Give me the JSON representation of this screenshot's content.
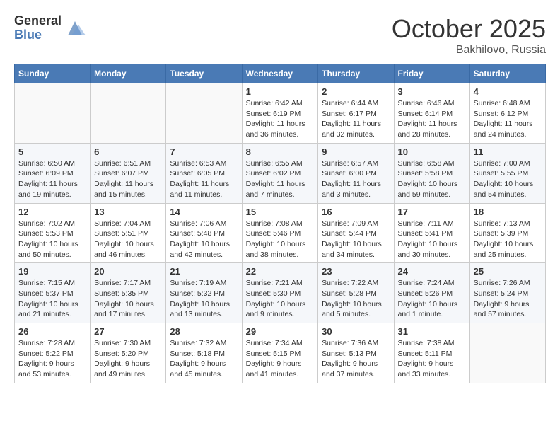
{
  "header": {
    "logo_general": "General",
    "logo_blue": "Blue",
    "month_title": "October 2025",
    "subtitle": "Bakhilovo, Russia"
  },
  "days_of_week": [
    "Sunday",
    "Monday",
    "Tuesday",
    "Wednesday",
    "Thursday",
    "Friday",
    "Saturday"
  ],
  "weeks": [
    [
      {
        "day": "",
        "info": ""
      },
      {
        "day": "",
        "info": ""
      },
      {
        "day": "",
        "info": ""
      },
      {
        "day": "1",
        "info": "Sunrise: 6:42 AM\nSunset: 6:19 PM\nDaylight: 11 hours\nand 36 minutes."
      },
      {
        "day": "2",
        "info": "Sunrise: 6:44 AM\nSunset: 6:17 PM\nDaylight: 11 hours\nand 32 minutes."
      },
      {
        "day": "3",
        "info": "Sunrise: 6:46 AM\nSunset: 6:14 PM\nDaylight: 11 hours\nand 28 minutes."
      },
      {
        "day": "4",
        "info": "Sunrise: 6:48 AM\nSunset: 6:12 PM\nDaylight: 11 hours\nand 24 minutes."
      }
    ],
    [
      {
        "day": "5",
        "info": "Sunrise: 6:50 AM\nSunset: 6:09 PM\nDaylight: 11 hours\nand 19 minutes."
      },
      {
        "day": "6",
        "info": "Sunrise: 6:51 AM\nSunset: 6:07 PM\nDaylight: 11 hours\nand 15 minutes."
      },
      {
        "day": "7",
        "info": "Sunrise: 6:53 AM\nSunset: 6:05 PM\nDaylight: 11 hours\nand 11 minutes."
      },
      {
        "day": "8",
        "info": "Sunrise: 6:55 AM\nSunset: 6:02 PM\nDaylight: 11 hours\nand 7 minutes."
      },
      {
        "day": "9",
        "info": "Sunrise: 6:57 AM\nSunset: 6:00 PM\nDaylight: 11 hours\nand 3 minutes."
      },
      {
        "day": "10",
        "info": "Sunrise: 6:58 AM\nSunset: 5:58 PM\nDaylight: 10 hours\nand 59 minutes."
      },
      {
        "day": "11",
        "info": "Sunrise: 7:00 AM\nSunset: 5:55 PM\nDaylight: 10 hours\nand 54 minutes."
      }
    ],
    [
      {
        "day": "12",
        "info": "Sunrise: 7:02 AM\nSunset: 5:53 PM\nDaylight: 10 hours\nand 50 minutes."
      },
      {
        "day": "13",
        "info": "Sunrise: 7:04 AM\nSunset: 5:51 PM\nDaylight: 10 hours\nand 46 minutes."
      },
      {
        "day": "14",
        "info": "Sunrise: 7:06 AM\nSunset: 5:48 PM\nDaylight: 10 hours\nand 42 minutes."
      },
      {
        "day": "15",
        "info": "Sunrise: 7:08 AM\nSunset: 5:46 PM\nDaylight: 10 hours\nand 38 minutes."
      },
      {
        "day": "16",
        "info": "Sunrise: 7:09 AM\nSunset: 5:44 PM\nDaylight: 10 hours\nand 34 minutes."
      },
      {
        "day": "17",
        "info": "Sunrise: 7:11 AM\nSunset: 5:41 PM\nDaylight: 10 hours\nand 30 minutes."
      },
      {
        "day": "18",
        "info": "Sunrise: 7:13 AM\nSunset: 5:39 PM\nDaylight: 10 hours\nand 25 minutes."
      }
    ],
    [
      {
        "day": "19",
        "info": "Sunrise: 7:15 AM\nSunset: 5:37 PM\nDaylight: 10 hours\nand 21 minutes."
      },
      {
        "day": "20",
        "info": "Sunrise: 7:17 AM\nSunset: 5:35 PM\nDaylight: 10 hours\nand 17 minutes."
      },
      {
        "day": "21",
        "info": "Sunrise: 7:19 AM\nSunset: 5:32 PM\nDaylight: 10 hours\nand 13 minutes."
      },
      {
        "day": "22",
        "info": "Sunrise: 7:21 AM\nSunset: 5:30 PM\nDaylight: 10 hours\nand 9 minutes."
      },
      {
        "day": "23",
        "info": "Sunrise: 7:22 AM\nSunset: 5:28 PM\nDaylight: 10 hours\nand 5 minutes."
      },
      {
        "day": "24",
        "info": "Sunrise: 7:24 AM\nSunset: 5:26 PM\nDaylight: 10 hours\nand 1 minute."
      },
      {
        "day": "25",
        "info": "Sunrise: 7:26 AM\nSunset: 5:24 PM\nDaylight: 9 hours\nand 57 minutes."
      }
    ],
    [
      {
        "day": "26",
        "info": "Sunrise: 7:28 AM\nSunset: 5:22 PM\nDaylight: 9 hours\nand 53 minutes."
      },
      {
        "day": "27",
        "info": "Sunrise: 7:30 AM\nSunset: 5:20 PM\nDaylight: 9 hours\nand 49 minutes."
      },
      {
        "day": "28",
        "info": "Sunrise: 7:32 AM\nSunset: 5:18 PM\nDaylight: 9 hours\nand 45 minutes."
      },
      {
        "day": "29",
        "info": "Sunrise: 7:34 AM\nSunset: 5:15 PM\nDaylight: 9 hours\nand 41 minutes."
      },
      {
        "day": "30",
        "info": "Sunrise: 7:36 AM\nSunset: 5:13 PM\nDaylight: 9 hours\nand 37 minutes."
      },
      {
        "day": "31",
        "info": "Sunrise: 7:38 AM\nSunset: 5:11 PM\nDaylight: 9 hours\nand 33 minutes."
      },
      {
        "day": "",
        "info": ""
      }
    ]
  ]
}
